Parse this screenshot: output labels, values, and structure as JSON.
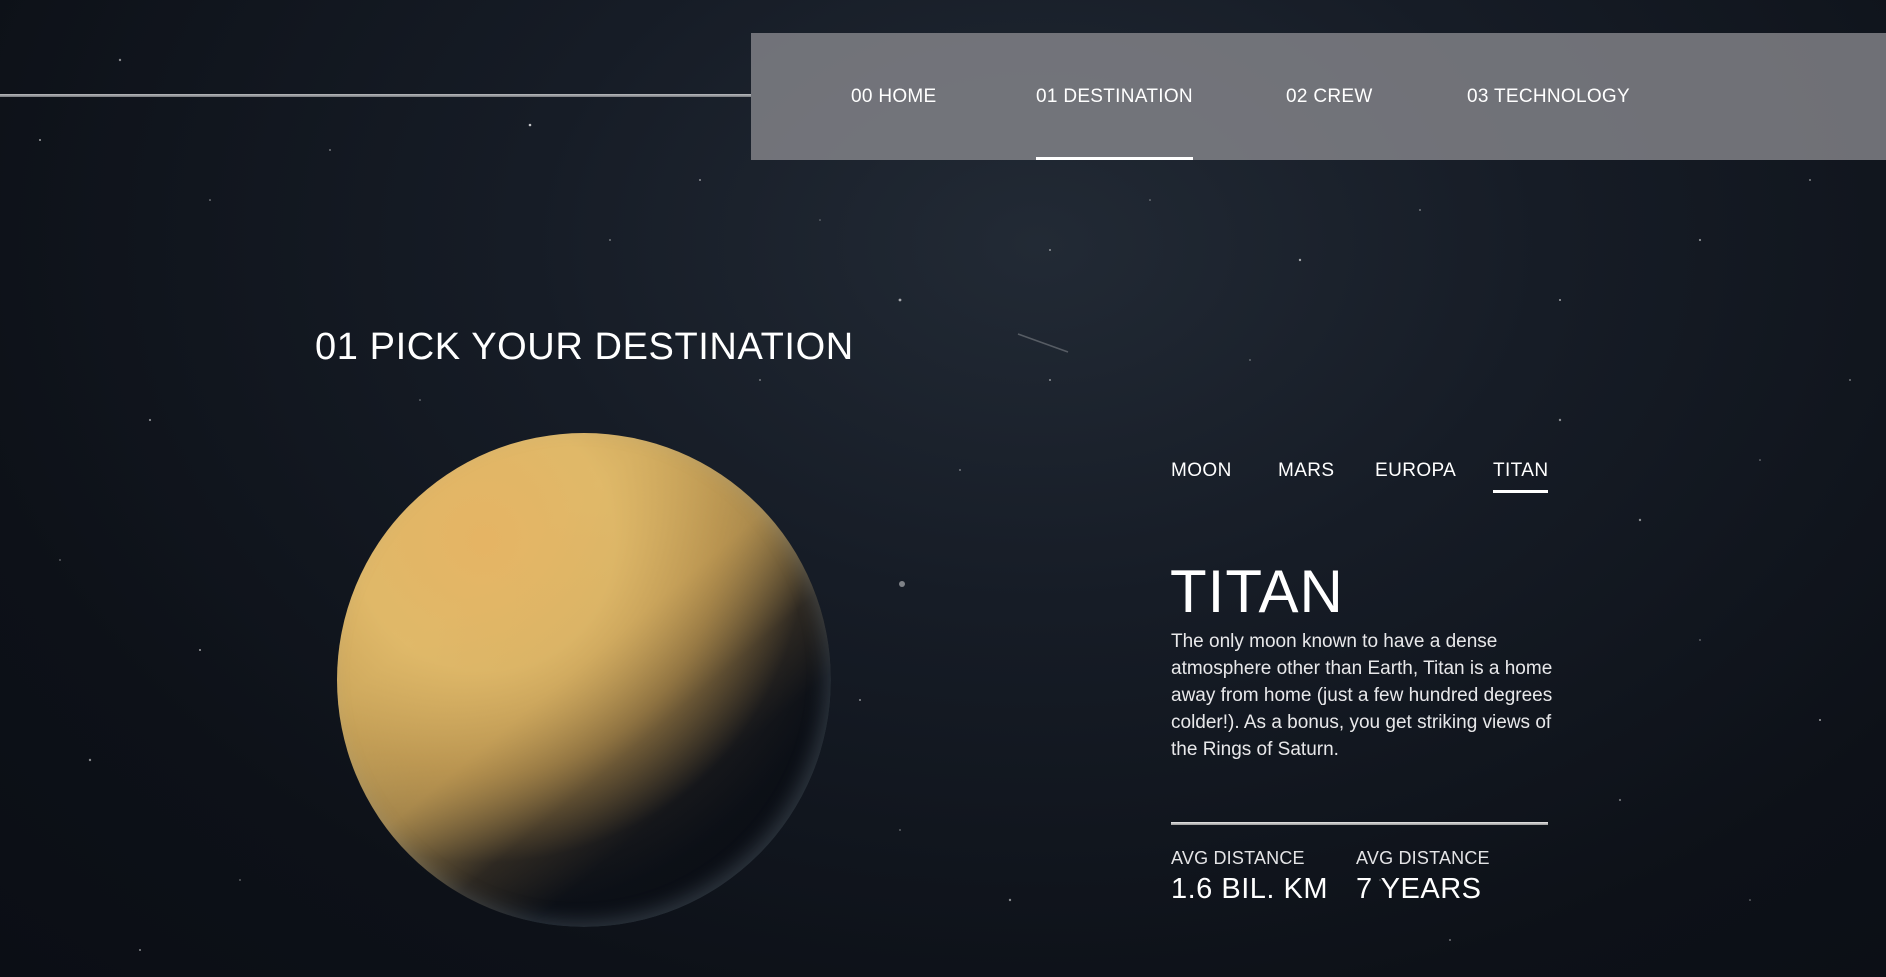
{
  "nav": {
    "items": [
      {
        "label": "00 HOME",
        "active": false
      },
      {
        "label": "01 DESTINATION",
        "active": true
      },
      {
        "label": "02 CREW",
        "active": false
      },
      {
        "label": "03 TECHNOLOGY",
        "active": false
      }
    ]
  },
  "page": {
    "title": "01 PICK YOUR DESTINATION"
  },
  "destination": {
    "tabs": [
      {
        "label": "MOON",
        "active": false
      },
      {
        "label": "MARS",
        "active": false
      },
      {
        "label": "EUROPA",
        "active": false
      },
      {
        "label": "TITAN",
        "active": true
      }
    ],
    "name": "TITAN",
    "description": "The only moon known to have a dense atmosphere other than Earth, Titan is a home away from home (just a few hundred degrees colder!). As a bonus, you get striking views of the Rings of Saturn.",
    "stats": [
      {
        "label": "AVG DISTANCE",
        "value": "1.6 BIL. KM"
      },
      {
        "label": "AVG DISTANCE",
        "value": "7 YEARS"
      }
    ],
    "image_icon": "titan-planet-image"
  },
  "colors": {
    "background": "#0b0e15",
    "navbar": "#8a8b8f",
    "text": "#ffffff",
    "planet": "#d8b868"
  }
}
